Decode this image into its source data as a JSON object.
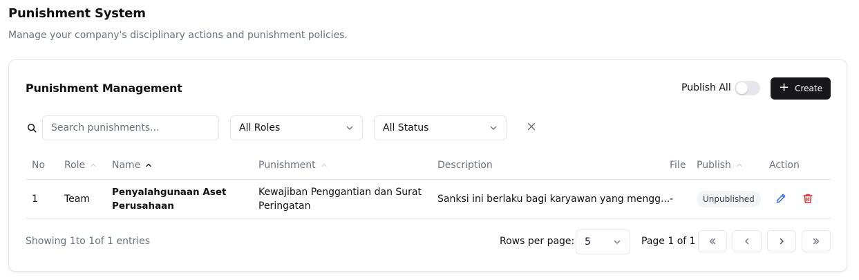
{
  "page": {
    "title": "Punishment System",
    "subtitle": "Manage your company's disciplinary actions and punishment policies."
  },
  "card": {
    "title": "Punishment Management",
    "publish_all_label": "Publish All",
    "publish_all_on": false,
    "create_label": "Create"
  },
  "filters": {
    "search_placeholder": "Search punishments...",
    "search_value": "",
    "role_selected": "All Roles",
    "status_selected": "All Status"
  },
  "table": {
    "columns": [
      "No",
      "Role",
      "Name",
      "Punishment",
      "Description",
      "File",
      "Publish",
      "Action"
    ],
    "rows": [
      {
        "no": "1",
        "role": "Team",
        "name_line1": "Penyalahgunaan Aset",
        "name_line2": "Perusahaan",
        "punishment_line1": "Kewajiban Penggantian dan Surat",
        "punishment_line2": "Peringatan",
        "description": "Sanksi ini berlaku bagi karyawan yang mengg...",
        "file": "-",
        "publish": "Unpublished"
      }
    ]
  },
  "footer": {
    "showing": "Showing 1to 1of 1 entries",
    "rows_per_page_label": "Rows per page:",
    "rows_per_page_value": "5",
    "page_info": "Page 1 of 1"
  },
  "icons": {
    "search": "search-icon",
    "chevron": "chevron-down-icon",
    "clear": "close-icon",
    "sort": "chevron-up-icon",
    "edit": "pencil-icon",
    "delete": "trash-icon",
    "first": "chevrons-left-icon",
    "prev": "chevron-left-icon",
    "next": "chevron-right-icon",
    "last": "chevrons-right-icon"
  },
  "colors": {
    "primary_button": "#18181b",
    "edit_icon": "#2563eb",
    "delete_icon": "#dc2626",
    "badge_bg": "#f3f4f6"
  }
}
